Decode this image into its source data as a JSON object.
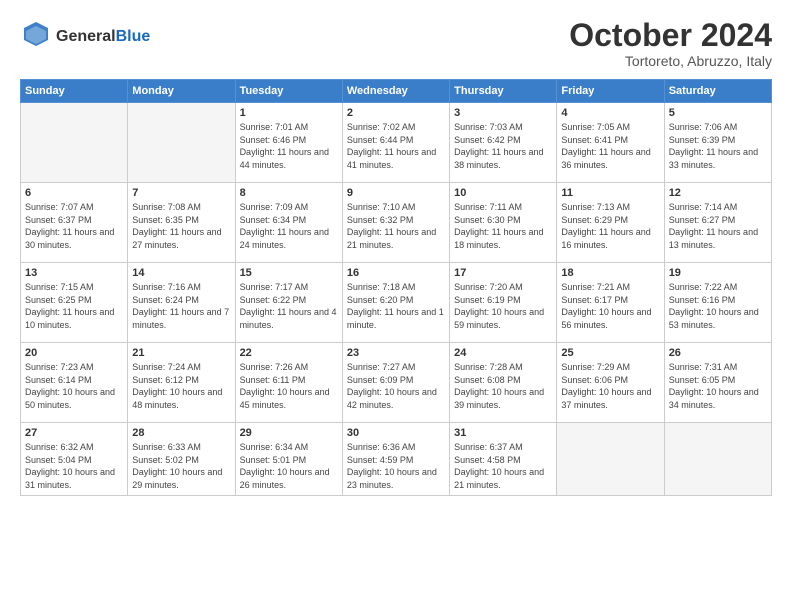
{
  "logo": {
    "general": "General",
    "blue": "Blue"
  },
  "header": {
    "month": "October 2024",
    "location": "Tortoreto, Abruzzo, Italy"
  },
  "weekdays": [
    "Sunday",
    "Monday",
    "Tuesday",
    "Wednesday",
    "Thursday",
    "Friday",
    "Saturday"
  ],
  "weeks": [
    [
      {
        "day": "",
        "detail": ""
      },
      {
        "day": "",
        "detail": ""
      },
      {
        "day": "1",
        "detail": "Sunrise: 7:01 AM\nSunset: 6:46 PM\nDaylight: 11 hours and 44 minutes."
      },
      {
        "day": "2",
        "detail": "Sunrise: 7:02 AM\nSunset: 6:44 PM\nDaylight: 11 hours and 41 minutes."
      },
      {
        "day": "3",
        "detail": "Sunrise: 7:03 AM\nSunset: 6:42 PM\nDaylight: 11 hours and 38 minutes."
      },
      {
        "day": "4",
        "detail": "Sunrise: 7:05 AM\nSunset: 6:41 PM\nDaylight: 11 hours and 36 minutes."
      },
      {
        "day": "5",
        "detail": "Sunrise: 7:06 AM\nSunset: 6:39 PM\nDaylight: 11 hours and 33 minutes."
      }
    ],
    [
      {
        "day": "6",
        "detail": "Sunrise: 7:07 AM\nSunset: 6:37 PM\nDaylight: 11 hours and 30 minutes."
      },
      {
        "day": "7",
        "detail": "Sunrise: 7:08 AM\nSunset: 6:35 PM\nDaylight: 11 hours and 27 minutes."
      },
      {
        "day": "8",
        "detail": "Sunrise: 7:09 AM\nSunset: 6:34 PM\nDaylight: 11 hours and 24 minutes."
      },
      {
        "day": "9",
        "detail": "Sunrise: 7:10 AM\nSunset: 6:32 PM\nDaylight: 11 hours and 21 minutes."
      },
      {
        "day": "10",
        "detail": "Sunrise: 7:11 AM\nSunset: 6:30 PM\nDaylight: 11 hours and 18 minutes."
      },
      {
        "day": "11",
        "detail": "Sunrise: 7:13 AM\nSunset: 6:29 PM\nDaylight: 11 hours and 16 minutes."
      },
      {
        "day": "12",
        "detail": "Sunrise: 7:14 AM\nSunset: 6:27 PM\nDaylight: 11 hours and 13 minutes."
      }
    ],
    [
      {
        "day": "13",
        "detail": "Sunrise: 7:15 AM\nSunset: 6:25 PM\nDaylight: 11 hours and 10 minutes."
      },
      {
        "day": "14",
        "detail": "Sunrise: 7:16 AM\nSunset: 6:24 PM\nDaylight: 11 hours and 7 minutes."
      },
      {
        "day": "15",
        "detail": "Sunrise: 7:17 AM\nSunset: 6:22 PM\nDaylight: 11 hours and 4 minutes."
      },
      {
        "day": "16",
        "detail": "Sunrise: 7:18 AM\nSunset: 6:20 PM\nDaylight: 11 hours and 1 minute."
      },
      {
        "day": "17",
        "detail": "Sunrise: 7:20 AM\nSunset: 6:19 PM\nDaylight: 10 hours and 59 minutes."
      },
      {
        "day": "18",
        "detail": "Sunrise: 7:21 AM\nSunset: 6:17 PM\nDaylight: 10 hours and 56 minutes."
      },
      {
        "day": "19",
        "detail": "Sunrise: 7:22 AM\nSunset: 6:16 PM\nDaylight: 10 hours and 53 minutes."
      }
    ],
    [
      {
        "day": "20",
        "detail": "Sunrise: 7:23 AM\nSunset: 6:14 PM\nDaylight: 10 hours and 50 minutes."
      },
      {
        "day": "21",
        "detail": "Sunrise: 7:24 AM\nSunset: 6:12 PM\nDaylight: 10 hours and 48 minutes."
      },
      {
        "day": "22",
        "detail": "Sunrise: 7:26 AM\nSunset: 6:11 PM\nDaylight: 10 hours and 45 minutes."
      },
      {
        "day": "23",
        "detail": "Sunrise: 7:27 AM\nSunset: 6:09 PM\nDaylight: 10 hours and 42 minutes."
      },
      {
        "day": "24",
        "detail": "Sunrise: 7:28 AM\nSunset: 6:08 PM\nDaylight: 10 hours and 39 minutes."
      },
      {
        "day": "25",
        "detail": "Sunrise: 7:29 AM\nSunset: 6:06 PM\nDaylight: 10 hours and 37 minutes."
      },
      {
        "day": "26",
        "detail": "Sunrise: 7:31 AM\nSunset: 6:05 PM\nDaylight: 10 hours and 34 minutes."
      }
    ],
    [
      {
        "day": "27",
        "detail": "Sunrise: 6:32 AM\nSunset: 5:04 PM\nDaylight: 10 hours and 31 minutes."
      },
      {
        "day": "28",
        "detail": "Sunrise: 6:33 AM\nSunset: 5:02 PM\nDaylight: 10 hours and 29 minutes."
      },
      {
        "day": "29",
        "detail": "Sunrise: 6:34 AM\nSunset: 5:01 PM\nDaylight: 10 hours and 26 minutes."
      },
      {
        "day": "30",
        "detail": "Sunrise: 6:36 AM\nSunset: 4:59 PM\nDaylight: 10 hours and 23 minutes."
      },
      {
        "day": "31",
        "detail": "Sunrise: 6:37 AM\nSunset: 4:58 PM\nDaylight: 10 hours and 21 minutes."
      },
      {
        "day": "",
        "detail": ""
      },
      {
        "day": "",
        "detail": ""
      }
    ]
  ]
}
